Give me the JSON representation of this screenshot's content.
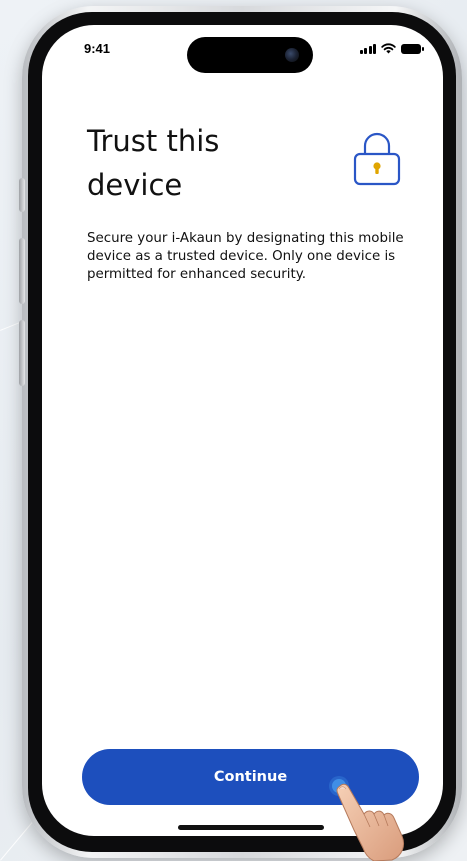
{
  "status_bar": {
    "time": "9:41",
    "icons": [
      "signal-icon",
      "wifi-icon",
      "battery-icon"
    ]
  },
  "header": {
    "title": "Trust this device",
    "icon": "lock-icon"
  },
  "body": {
    "description": "Secure your i-Akaun by designating this mobile device as a trusted device. Only one device is permitted for enhanced security."
  },
  "actions": {
    "continue_label": "Continue"
  },
  "colors": {
    "primary": "#1d4fbd",
    "lock_stroke": "#2a56c6",
    "lock_keyhole": "#e0a500",
    "text": "#111111",
    "background": "#ffffff"
  }
}
